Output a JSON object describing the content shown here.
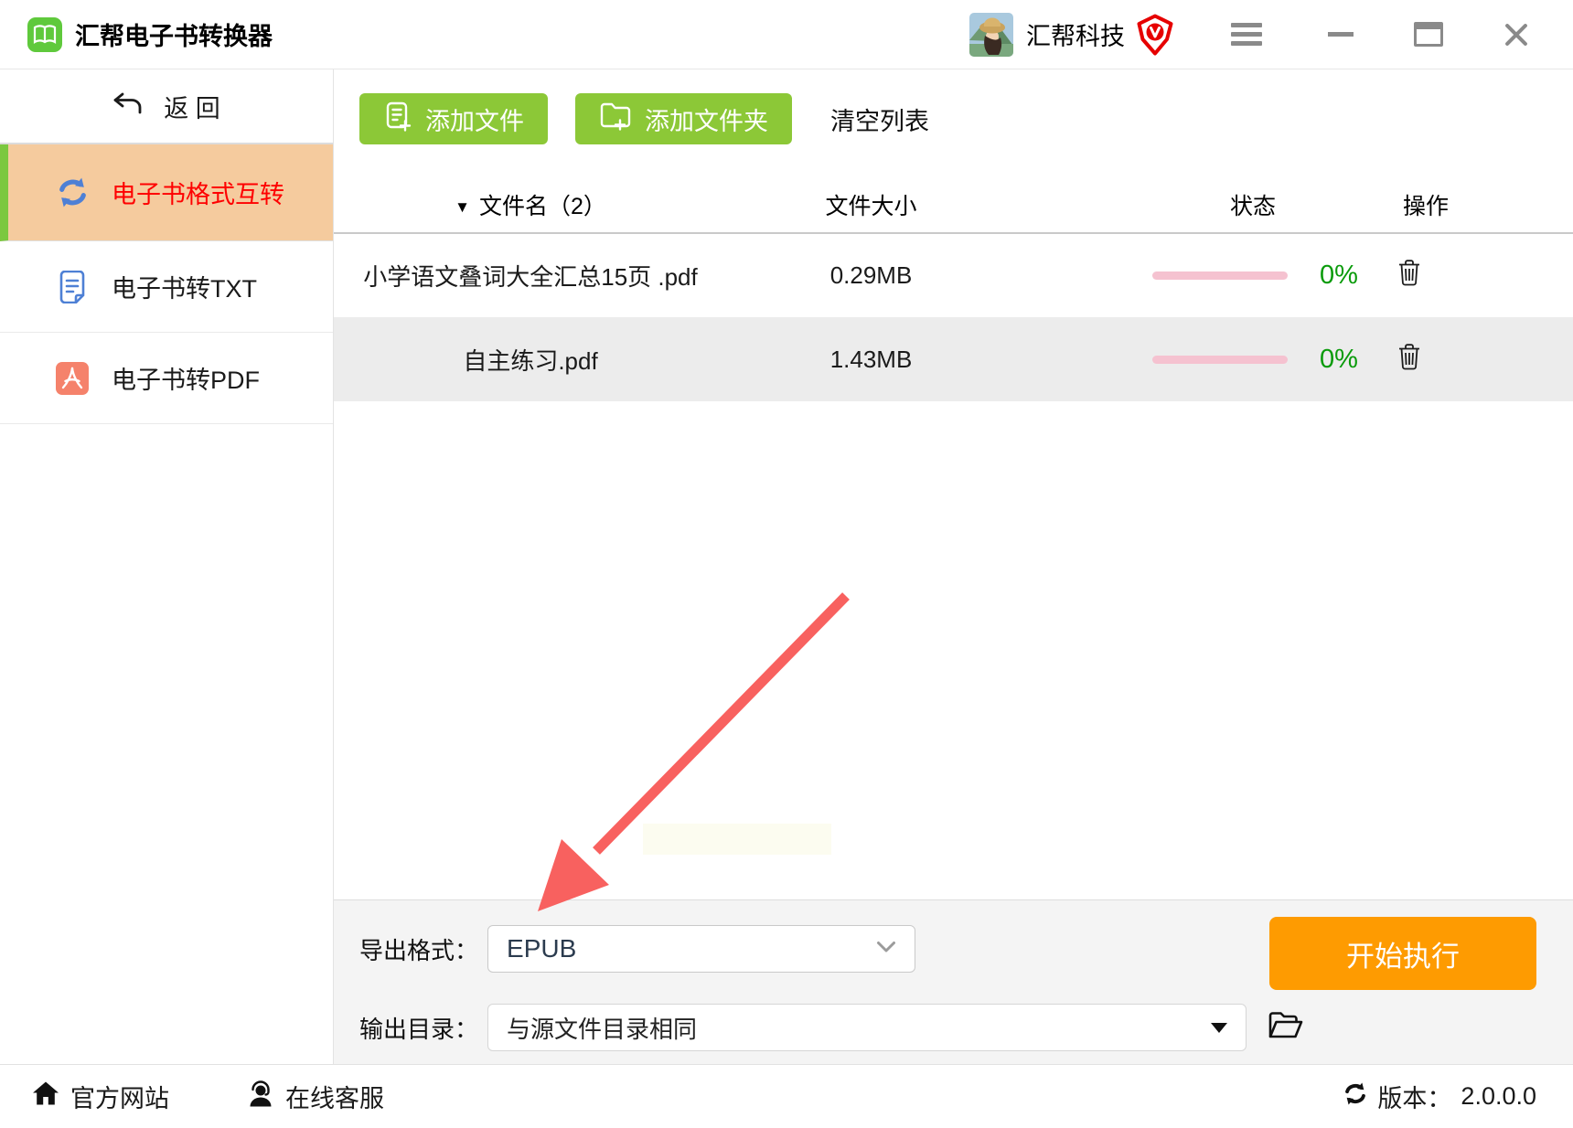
{
  "window": {
    "title": "汇帮电子书转换器",
    "brand": "汇帮科技"
  },
  "sidebar": {
    "back_label": "返 回",
    "items": [
      {
        "label": "电子书格式互转",
        "selected": true,
        "icon": "sync-arrows-icon"
      },
      {
        "label": "电子书转TXT",
        "selected": false,
        "icon": "document-icon"
      },
      {
        "label": "电子书转PDF",
        "selected": false,
        "icon": "pdf-icon"
      }
    ]
  },
  "toolbar": {
    "add_file": "添加文件",
    "add_folder": "添加文件夹",
    "clear_list": "清空列表"
  },
  "table": {
    "sort_caret": "▼",
    "headers": {
      "name": "文件名（2）",
      "size": "文件大小",
      "status": "状态",
      "ops": "操作"
    },
    "rows": [
      {
        "name": "小学语文叠词大全汇总15页 .pdf",
        "size": "0.29MB",
        "progress": "0%",
        "progress_value": 0
      },
      {
        "name": "自主练习.pdf",
        "size": "1.43MB",
        "progress": "0%",
        "progress_value": 0
      }
    ]
  },
  "export": {
    "format_label": "导出格式：",
    "format_value": "EPUB",
    "output_label": "输出目录：",
    "output_value": "与源文件目录相同",
    "start_button": "开始执行"
  },
  "footer": {
    "website": "官方网站",
    "support": "在线客服",
    "version_label": "版本：",
    "version_value": "2.0.0.0"
  },
  "icons": {
    "logo": "green open-book",
    "vip": "red shield with V check",
    "menu": "hamburger",
    "back": "undo-arrow",
    "add_file": "file-plus",
    "add_folder": "folder-plus",
    "sort": "down-triangle",
    "trash": "trash-can",
    "format_chevron": "chevron-down",
    "output_arrow": "filled down-triangle",
    "browse": "open-folder",
    "website": "house",
    "support": "headset-person",
    "version": "sync-arrows"
  },
  "colors": {
    "green_button": "#8cc837",
    "logo_green": "#5fc93c",
    "sidebar_selected_bg": "#f5cb9e",
    "sidebar_selected_bar": "#7cc83f",
    "selected_text": "#fe0000",
    "icon_blue": "#4e80d5",
    "pdf_icon": "#f5826b",
    "progress_track": "#f5c2d0",
    "percent_green": "#0a9b0b",
    "start_button": "#fe9b01",
    "annotation_arrow": "#f8615f",
    "vip_red": "#e60000"
  }
}
